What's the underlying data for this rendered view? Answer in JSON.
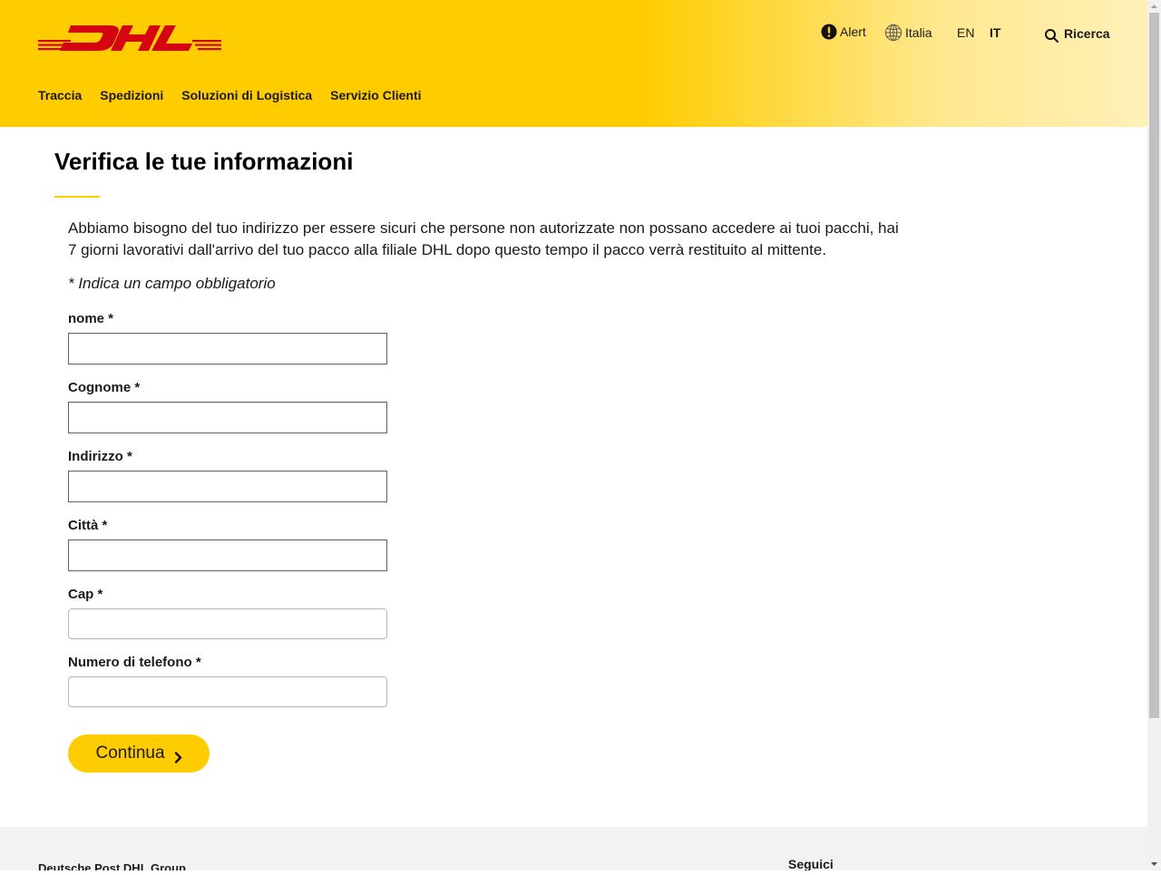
{
  "header": {
    "logo_text": "DHL",
    "utility": {
      "alert_label": "Alert",
      "alert_icon": "alert-icon",
      "country_label": "Italia",
      "country_icon": "globe-icon",
      "lang_en": "EN",
      "lang_it": "IT",
      "search_label": "Ricerca",
      "search_icon": "search-icon"
    },
    "nav": [
      {
        "label": "Traccia"
      },
      {
        "label": "Spedizioni"
      },
      {
        "label": "Soluzioni di Logistica"
      },
      {
        "label": "Servizio Clienti"
      }
    ]
  },
  "colors": {
    "brand_yellow": "#ffcc00",
    "brand_red": "#d40511"
  },
  "main": {
    "title": "Verifica le tue informazioni",
    "intro": "Abbiamo bisogno del tuo indirizzo per essere sicuri che persone non autorizzate non possano accedere ai tuoi pacchi, hai 7 giorni lavorativi dall'arrivo del tuo pacco alla filiale DHL dopo questo tempo il pacco verrà restituito al mittente.",
    "required_note": "* Indica un campo obbligatorio",
    "form": {
      "fields": [
        {
          "label": "nome *",
          "value": "",
          "placeholder": ""
        },
        {
          "label": "Cognome *",
          "value": "",
          "placeholder": ""
        },
        {
          "label": "Indirizzo *",
          "value": "",
          "placeholder": ""
        },
        {
          "label": "Città *",
          "value": "",
          "placeholder": ""
        },
        {
          "label": "Cap *",
          "value": "",
          "placeholder": ""
        },
        {
          "label": "Numero di telefono *",
          "value": "",
          "placeholder": ""
        }
      ],
      "submit_label": "Continua",
      "submit_icon": "chevron-right-icon"
    }
  },
  "footer": {
    "brand": "Deutsche Post DHL Group",
    "follow_label": "Seguici"
  }
}
